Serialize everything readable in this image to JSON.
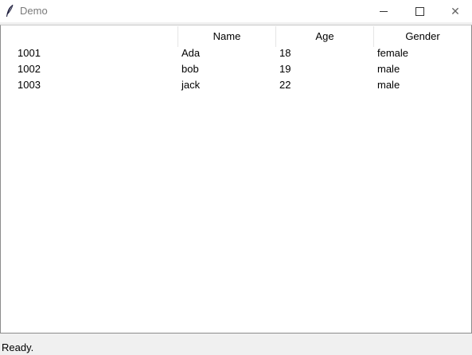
{
  "window": {
    "title": "Demo",
    "icon": "feather-icon",
    "controls": [
      "minimize-icon",
      "maximize-icon",
      "close-icon"
    ],
    "close_glyph": "✕"
  },
  "table": {
    "columns": [
      "",
      "Name",
      "Age",
      "Gender"
    ],
    "rows": [
      [
        "1001",
        "Ada",
        "18",
        "female"
      ],
      [
        "1002",
        "bob",
        "19",
        "male"
      ],
      [
        "1003",
        "jack",
        "22",
        "male"
      ]
    ]
  },
  "status": {
    "text": "Ready."
  }
}
